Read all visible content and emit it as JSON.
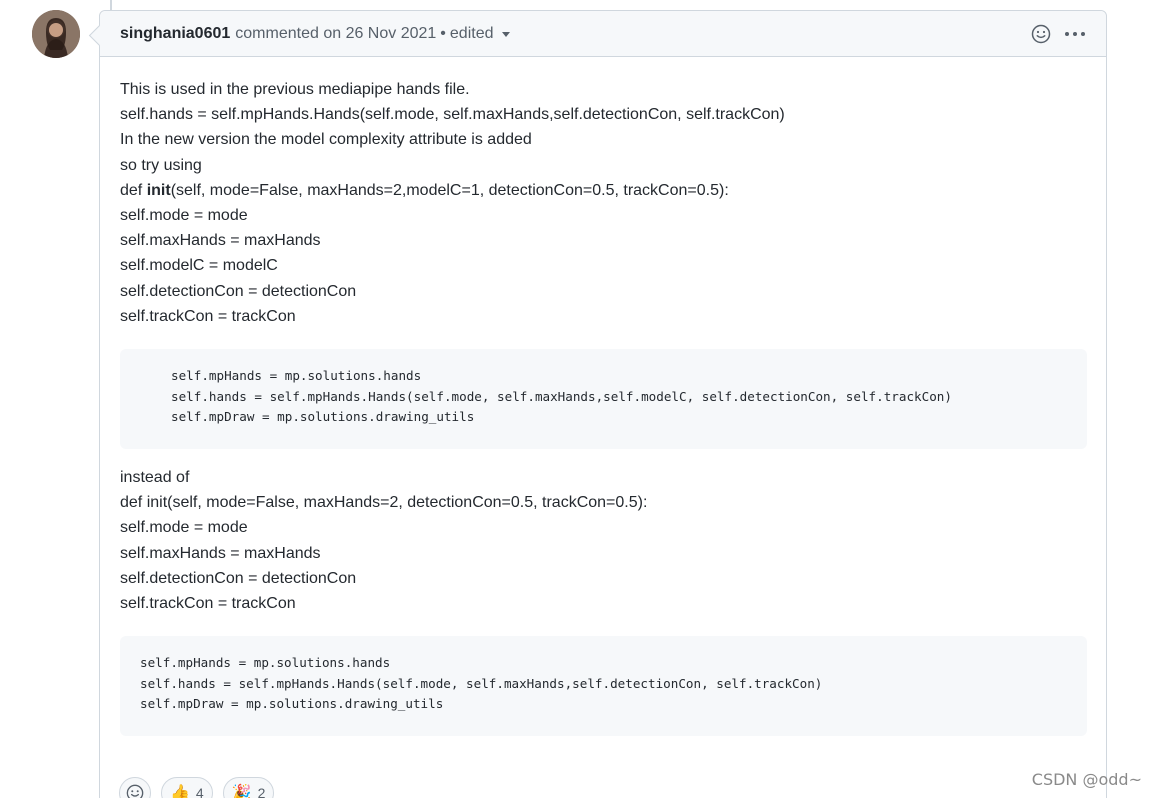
{
  "comment": {
    "author": "singhania0601",
    "action": "commented on 26 Nov 2021",
    "separator": "•",
    "edited": "edited",
    "header_icons": [
      "smiley-icon",
      "kebab-icon"
    ]
  },
  "body": {
    "para1": [
      "This is used in the previous mediapipe hands file.",
      "self.hands = self.mpHands.Hands(self.mode, self.maxHands,self.detectionCon, self.trackCon)",
      "In the new version the model complexity attribute is added",
      "so try using"
    ],
    "def1_prefix": "def ",
    "def1_bold": "init",
    "def1_suffix": "(self, mode=False, maxHands=2,modelC=1, detectionCon=0.5, trackCon=0.5):",
    "para1b": [
      "self.mode = mode",
      "self.maxHands = maxHands",
      "self.modelC = modelC",
      "self.detectionCon = detectionCon",
      "self.trackCon = trackCon"
    ],
    "code1": [
      "self.mpHands = mp.solutions.hands",
      "self.hands = self.mpHands.Hands(self.mode, self.maxHands,self.modelC, self.detectionCon, self.trackCon)",
      "self.mpDraw = mp.solutions.drawing_utils"
    ],
    "para2": [
      "instead of",
      "def init(self, mode=False, maxHands=2, detectionCon=0.5, trackCon=0.5):",
      "self.mode = mode",
      "self.maxHands = maxHands",
      "self.detectionCon = detectionCon",
      "self.trackCon = trackCon"
    ],
    "code2": [
      "self.mpHands = mp.solutions.hands",
      "self.hands = self.mpHands.Hands(self.mode, self.maxHands,self.detectionCon, self.trackCon)",
      "self.mpDraw = mp.solutions.drawing_utils"
    ]
  },
  "reactions": [
    {
      "icon": "add-reaction-icon",
      "count": ""
    },
    {
      "icon": "thumbs-up-icon",
      "emoji": "👍",
      "count": "4"
    },
    {
      "icon": "party-icon",
      "emoji": "🎉",
      "count": "2"
    }
  ],
  "watermark": "CSDN @odd~"
}
